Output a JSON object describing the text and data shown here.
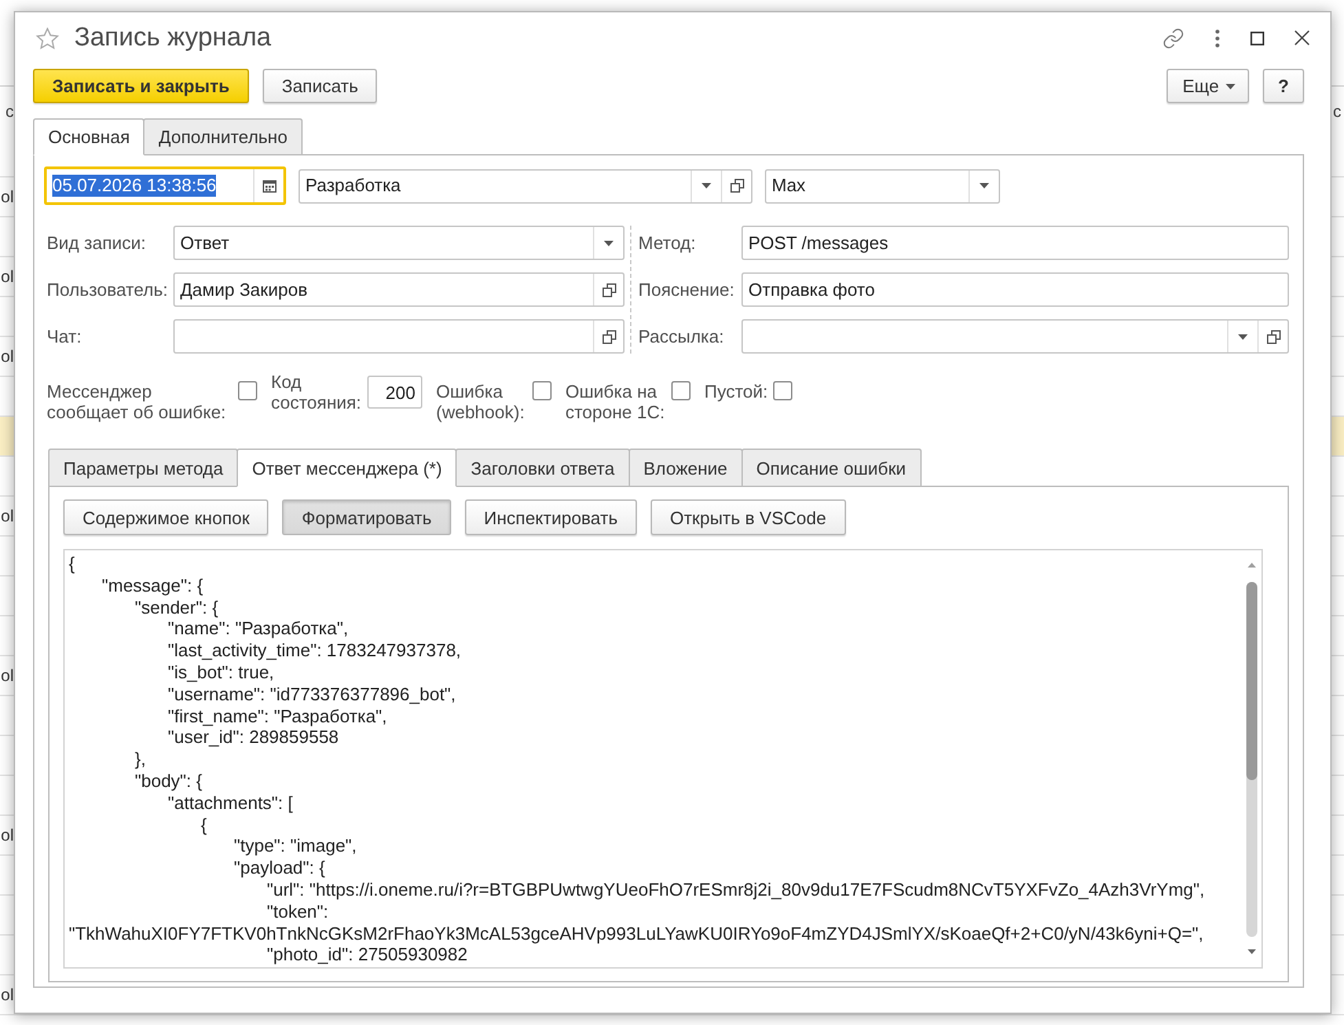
{
  "background_list": {
    "header": {
      "column_1": "с",
      "column_2": "с"
    },
    "rows": [
      {
        "column_1": "ol",
        "selected": false
      },
      {
        "selected": false
      },
      {
        "column_1": "ol",
        "selected": false
      },
      {
        "selected": false
      },
      {
        "column_1": "ol",
        "selected": false
      },
      {
        "selected": false
      },
      {
        "selected": true
      },
      {
        "selected": false
      },
      {
        "column_1": "ol",
        "selected": false
      },
      {
        "selected": false
      },
      {
        "selected": false
      },
      {
        "selected": false
      },
      {
        "column_1": "ol",
        "selected": false
      },
      {
        "selected": false
      },
      {
        "selected": false
      },
      {
        "selected": false
      },
      {
        "column_1": "ol",
        "selected": false
      },
      {
        "selected": false
      },
      {
        "selected": false
      },
      {
        "selected": false
      },
      {
        "column_1": "ol",
        "selected": false
      },
      {
        "selected": false
      }
    ]
  },
  "window": {
    "title": "Запись журнала",
    "favorite": false
  },
  "toolbar": {
    "buttons": [
      {
        "label": "Записать и закрыть",
        "kind": "primary"
      },
      {
        "label": "Записать",
        "kind": "normal"
      }
    ],
    "more": "Еще",
    "help": "?"
  },
  "tabs": [
    {
      "label": "Основная",
      "selected": true
    },
    {
      "label": "Дополнительно",
      "selected": false
    }
  ],
  "header_fields": [
    {
      "kind": "date",
      "value": "05.07.2026 13:38:56",
      "focused": true,
      "text_selected": true
    },
    {
      "kind": "select_open",
      "value": "Разработка",
      "focused": false,
      "text_selected": false
    },
    {
      "kind": "select",
      "value": "Max",
      "focused": false,
      "text_selected": false
    }
  ],
  "left_fields": [
    {
      "label": "Вид записи:",
      "kind": "select",
      "value": "Ответ"
    },
    {
      "label": "Пользователь:",
      "kind": "open",
      "value": "Дамир Закиров"
    },
    {
      "label": "Чат:",
      "kind": "open"
    }
  ],
  "right_fields": [
    {
      "label": "Метод:",
      "kind": "text",
      "value": "POST /messages"
    },
    {
      "label": "Пояснение:",
      "kind": "text",
      "value": "Отправка фото"
    },
    {
      "label": "Рассылка:",
      "kind": "select_open"
    }
  ],
  "flags": [
    {
      "label": "Мессенджер сообщает об ошибке:",
      "kind": "checkbox",
      "checked": false
    },
    {
      "label": "Код состояния:",
      "kind": "number",
      "value": "200"
    },
    {
      "label": "Ошибка (webhook):",
      "kind": "checkbox",
      "checked": false
    },
    {
      "label": "Ошибка на стороне 1С:",
      "kind": "checkbox",
      "checked": false
    },
    {
      "label": "Пустой:",
      "kind": "checkbox",
      "checked": false
    }
  ],
  "response_tabs": [
    {
      "label": "Параметры метода",
      "selected": false
    },
    {
      "label": "Ответ мессенджера (*)",
      "selected": true
    },
    {
      "label": "Заголовки ответа",
      "selected": false
    },
    {
      "label": "Вложение",
      "selected": false
    },
    {
      "label": "Описание ошибки",
      "selected": false
    }
  ],
  "response_buttons": [
    {
      "label": "Содержимое кнопок",
      "pressed": false
    },
    {
      "label": "Форматировать",
      "pressed": true
    },
    {
      "label": "Инспектировать",
      "pressed": false
    },
    {
      "label": "Открыть в VSCode",
      "pressed": false
    }
  ],
  "response_text": {
    "lines": [
      "{",
      "\t\"message\": {",
      "\t\t\"sender\": {",
      "\t\t\t\"name\": \"Разработка\",",
      "\t\t\t\"last_activity_time\": 1783247937378,",
      "\t\t\t\"is_bot\": true,",
      "\t\t\t\"username\": \"id773376377896_bot\",",
      "\t\t\t\"first_name\": \"Разработка\",",
      "\t\t\t\"user_id\": 289859558",
      "\t\t},",
      "\t\t\"body\": {",
      "\t\t\t\"attachments\": [",
      "\t\t\t\t{",
      "\t\t\t\t\t\"type\": \"image\",",
      "\t\t\t\t\t\"payload\": {",
      "\t\t\t\t\t\t\"url\": \"https://i.oneme.ru/i?r=BTGBPUwtwgYUeoFhO7rESmr8j2i_80v9du17E7FScudm8NCvT5YXFvZo_4Azh3VrYmg\",",
      "\t\t\t\t\t\t\"token\": \"TkhWahuXI0FY7FTKV0hTnkNcGKsM2rFhaoYk3McAL53gceAHVp993LuLYawKU0IRYo9oF4mZYD4JSmlYX/sKoaeQf+2+C0/yN/43k6yni+Q=\",",
      "\t\t\t\t\t\t\"photo_id\": 27505930982"
    ]
  }
}
